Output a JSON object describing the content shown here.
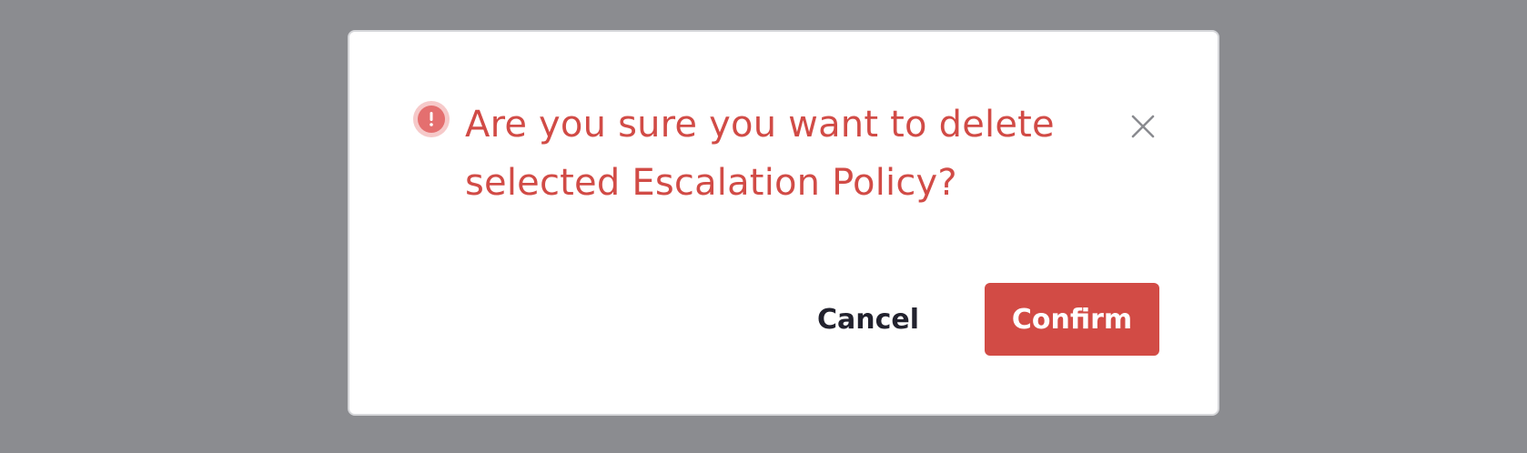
{
  "dialog": {
    "title": "Are you sure you want to delete selected Escalation Policy?",
    "icon": "alert-circle-icon",
    "close_icon": "close-icon"
  },
  "actions": {
    "cancel_label": "Cancel",
    "confirm_label": "Confirm"
  },
  "colors": {
    "overlay": "#8b8c90",
    "danger": "#d24b45",
    "danger_light": "#f6c9c9",
    "text_dark": "#22222e",
    "close_icon": "#8a8b90"
  }
}
